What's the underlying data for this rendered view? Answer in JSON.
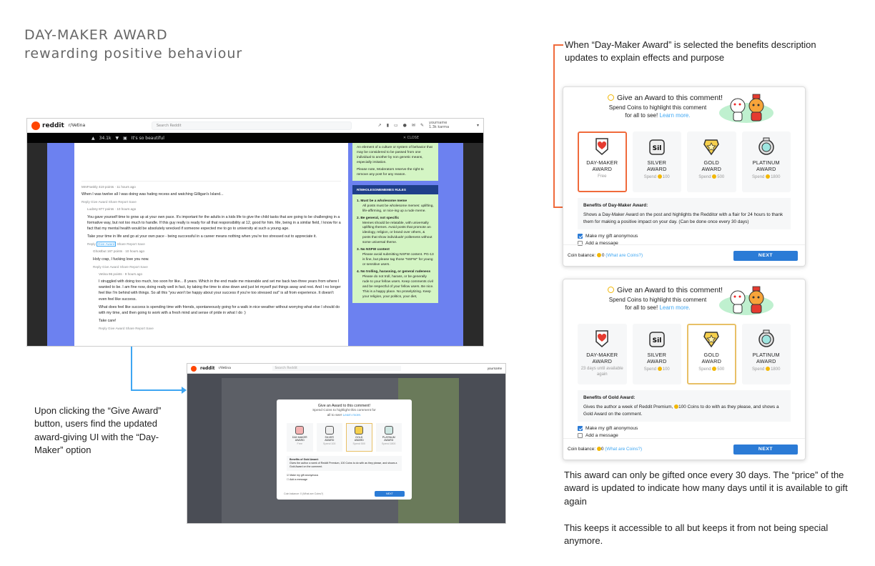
{
  "page": {
    "title": "DAY-MAKER AWARD",
    "subtitle": "rewarding positive behaviour",
    "annotation_top_right": "When “Day-Maker Award” is selected the benefits description updates to explain effects and purpose",
    "annotation_left": "Upon clicking the “Give Award” button, users find the updated award-giving UI with the “Day-Maker” option",
    "annotation_bottom_right_1": "This award can only be gifted once every 30 days. The “price” of the award is updated to indicate how many days until it is available to gift again",
    "annotation_bottom_right_2": "This keeps it accessible to all but keeps it from not being special anymore.",
    "colors": {
      "accent_orange": "#f06a3b",
      "accent_blue": "#3ea6f2",
      "next_button": "#2b7bd6"
    }
  },
  "reddit": {
    "logo": "reddit",
    "subreddit": "r/Vetina",
    "search_placeholder": "Search Reddit",
    "username": "yourname",
    "karma": "1.3k karma",
    "post_votes": "34.1k",
    "post_title": "It's so beautiful",
    "close": "✕ CLOSE",
    "comment1_meta": "MrsFrankly 419 points · 11 hours ago",
    "comment1_text": "When I was twelve all I was doing was hating recess and watching Gilligan's Island...",
    "comment1_actions": "Reply  Give Award  Share  Report  Save",
    "comment2_meta": "Ludzey 877 points · 10 hours ago",
    "comment2_text": "You gave yourself time to grow up at your own pace. It's important for the adults in a kids life to give the child tasks that are going to be challenging in a formative way, but not too much to handle. If this guy really is ready for all that responsibility at 12, good for him. Me, being in a similar field, I know for a fact that my mental health would be absolutely wrecked if someone expected me to go to university at such a young age.",
    "comment2_text2": "Take your time in life and go at your own pace - being successful in a career means nothing when you're too stressed out to appreciate it.",
    "comment2_actions_reply": "Reply",
    "comment2_actions_award": "Give Award",
    "comment2_actions_rest": "Share  Report  Save",
    "comment3_meta": "Ghostbut 167 points · 10 hours ago",
    "comment3_text": "Holy crap, I fucking love you now.",
    "comment3_actions": "Reply  Give Award  Share  Report  Save",
    "comment4_meta": "Vetina 96 points · 9 hours ago",
    "comment4_text": "I struggled with doing too much, too soon for like... 8 years. Which in the end made me miserable and set me back two-three years from where I wanted to be. I am fine now, doing really well in fact, by taking the time to slow down and just let myself put things away and rest. And I no longer feel like I'm behind with things. So all this \"you won't be happy about your success if you're too stressed out\" is all from experience. It doesn't even feel like success.",
    "comment4_text2": "What does feel like success is spending time with friends, spontaneously going for a walk in nice weather without worrying what else I should do with my time, and then going to work with a fresh mind and sense of pride in what I do :)",
    "comment4_text3": "Take care!",
    "comment4_actions": "Reply  Give Award  Share  Report  Save",
    "side_top_text": "An element of a culture or system of behavior that may be considered to be passed from one individual to another by non genetic means, especially imitation.",
    "side_top_text2": "Please note, Moderators reserve the right to remove any post for any reason.",
    "rules_header": "R/WHOLESOMEMEMES RULES",
    "rules": [
      {
        "title": "1. Must be a wholesome meme",
        "body": "All posts must be wholesome memes: uplifting, life-affirming, or nice-ing up a rude meme."
      },
      {
        "title": "2. Be general, not specific",
        "body": "Memes should be relatable, with universally uplifting themes. Avoid posts that promote an ideology, religion, or brand over others, & posts that show individuals' politeness without some universal theme."
      },
      {
        "title": "3. No NSFW content",
        "body": "Please avoid submitting NSFW content. PG-13 is fine, but please tag those \"NSFW\" for young or sensitive users."
      },
      {
        "title": "4. No trolling, harassing, or general rudeness",
        "body": "Please do not troll, harass, or be generally rude to your fellow users. Keep comments civil and be respectful of your fellow users. Be nice. This is a happy place. No proselytizing. Keep your religion, your politics, your diet,"
      }
    ]
  },
  "modal_common": {
    "title": "Give an Award to this comment!",
    "subtitle": "Spend Coins to highlight this comment for all to see!",
    "learn_more": "Learn more.",
    "anonymous_label": "Make my gift anonymous",
    "message_label": "Add a message",
    "coin_balance_label": "Coin balance:",
    "coin_balance_value": "0",
    "what_are_coins": "(What are Coins?)",
    "next": "NEXT"
  },
  "modal1": {
    "awards": [
      {
        "name": "DAY-MAKER\nAWARD",
        "line1": "DAY-MAKER",
        "line2": "AWARD",
        "price": "Free",
        "icon": "heart-icon"
      },
      {
        "name": "SILVER AWARD",
        "line1": "SILVER",
        "line2": "AWARD",
        "price": "Spend",
        "coins": "100",
        "icon": "silver-icon"
      },
      {
        "name": "GOLD AWARD",
        "line1": "GOLD",
        "line2": "AWARD",
        "price": "Spend",
        "coins": "500",
        "icon": "gold-star-icon"
      },
      {
        "name": "PLATINUM AWARD",
        "line1": "PLATINUM",
        "line2": "AWARD",
        "price": "Spend",
        "coins": "1800",
        "icon": "platinum-icon"
      }
    ],
    "benefits_title": "Benefits of Day-Maker Award:",
    "benefits_text": "Shows a Day-Maker Award on the post and highlights the Redditor with a flair for 24 hours to thank them for making a positive impact on your day. (Can be done once every 30 days)"
  },
  "modal2": {
    "day_maker_price": "23 days until available again",
    "benefits_title": "Benefits of Gold Award:",
    "benefits_text_pre": "Gives the author a week of Reddit Premium,",
    "benefits_coins": "100",
    "benefits_text_post": "Coins to do with as they please, and shows a Gold Award on the comment."
  },
  "shot2": {
    "title": "Give an Award to this comment!",
    "subtitle": "Spend Coins to highlight this comment for all to see!",
    "learn_more": "Learn more.",
    "awards": [
      {
        "line1": "DAY-MAKER",
        "line2": "AWARD",
        "price": "Free"
      },
      {
        "line1": "SILVER",
        "line2": "AWARD",
        "price": "Spend 100"
      },
      {
        "line1": "GOLD",
        "line2": "AWARD",
        "price": "Spend 500"
      },
      {
        "line1": "PLATINUM",
        "line2": "AWARD",
        "price": "Spend 1800"
      }
    ],
    "benefits_title": "Benefits of Gold Award:",
    "benefits_text": "Gives the author a week of Reddit Premium, 100 Coins to do with as they please, and shows a Gold Award on the comment.",
    "anonymous_label": "Make my gift anonymous",
    "message_label": "Add a message",
    "coin_balance": "Coin balance: 0 (What are Coins?)",
    "next": "NEXT"
  }
}
